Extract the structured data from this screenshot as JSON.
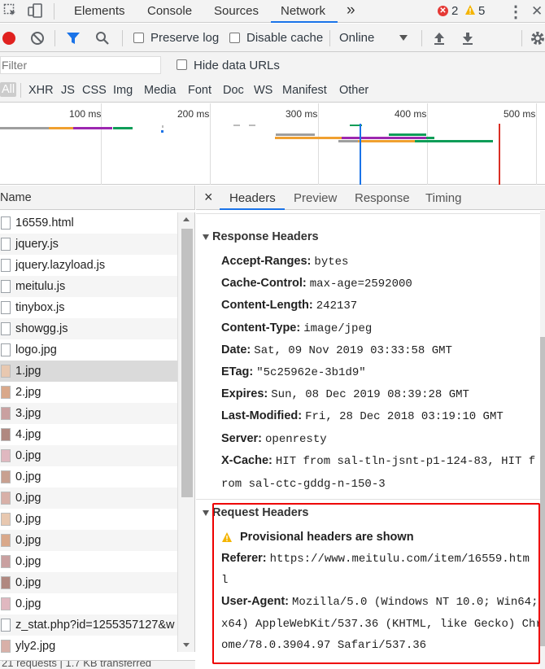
{
  "tabs": {
    "items": [
      "Elements",
      "Console",
      "Sources",
      "Network"
    ],
    "more": "»",
    "errors": "2",
    "warnings": "5",
    "menu": "⋮",
    "close": "✕"
  },
  "toolbar": {
    "preserve_log": "Preserve log",
    "disable_cache": "Disable cache",
    "throttle": "Online"
  },
  "filter": {
    "placeholder": "Filter",
    "hide_data_urls": "Hide data URLs"
  },
  "types": [
    "All",
    "XHR",
    "JS",
    "CSS",
    "Img",
    "Media",
    "Font",
    "Doc",
    "WS",
    "Manifest",
    "Other"
  ],
  "timeline": {
    "ticks": [
      "100 ms",
      "200 ms",
      "300 ms",
      "400 ms",
      "500 ms"
    ]
  },
  "list": {
    "header": "Name",
    "rows": [
      {
        "name": "16559.html",
        "kind": "file"
      },
      {
        "name": "jquery.js",
        "kind": "file"
      },
      {
        "name": "jquery.lazyload.js",
        "kind": "file"
      },
      {
        "name": "meitulu.js",
        "kind": "file"
      },
      {
        "name": "tinybox.js",
        "kind": "file"
      },
      {
        "name": "showgg.js",
        "kind": "file"
      },
      {
        "name": "logo.jpg",
        "kind": "file"
      },
      {
        "name": "1.jpg",
        "kind": "img"
      },
      {
        "name": "2.jpg",
        "kind": "img"
      },
      {
        "name": "3.jpg",
        "kind": "img"
      },
      {
        "name": "4.jpg",
        "kind": "img"
      },
      {
        "name": "0.jpg",
        "kind": "img"
      },
      {
        "name": "0.jpg",
        "kind": "img"
      },
      {
        "name": "0.jpg",
        "kind": "img"
      },
      {
        "name": "0.jpg",
        "kind": "img"
      },
      {
        "name": "0.jpg",
        "kind": "img"
      },
      {
        "name": "0.jpg",
        "kind": "img"
      },
      {
        "name": "0.jpg",
        "kind": "img"
      },
      {
        "name": "0.jpg",
        "kind": "img"
      },
      {
        "name": "z_stat.php?id=1255357127&w",
        "kind": "file"
      },
      {
        "name": "yly2.jpg",
        "kind": "img"
      }
    ],
    "status": "21 requests | 1.7 KB transferred"
  },
  "details": {
    "tabs": [
      "Headers",
      "Preview",
      "Response",
      "Timing"
    ],
    "close": "×",
    "response_title": "Response Headers",
    "response_headers": [
      {
        "k": "Accept-Ranges:",
        "v": "bytes"
      },
      {
        "k": "Cache-Control:",
        "v": "max-age=2592000"
      },
      {
        "k": "Content-Length:",
        "v": "242137"
      },
      {
        "k": "Content-Type:",
        "v": "image/jpeg"
      },
      {
        "k": "Date:",
        "v": "Sat, 09 Nov 2019 03:33:58 GMT"
      },
      {
        "k": "ETag:",
        "v": "\"5c25962e-3b1d9\""
      },
      {
        "k": "Expires:",
        "v": "Sun, 08 Dec 2019 08:39:28 GMT"
      },
      {
        "k": "Last-Modified:",
        "v": "Fri, 28 Dec 2018 03:19:10 GMT"
      },
      {
        "k": "Server:",
        "v": "openresty"
      },
      {
        "k": "X-Cache:",
        "v": "HIT from sal-tln-jsnt-p1-124-83, HIT f"
      }
    ],
    "xcache_cont": "rom sal-ctc-gddg-n-150-3",
    "request_title": "Request Headers",
    "provisional": "Provisional headers are shown",
    "referer_k": "Referer:",
    "referer_v": "https://www.meitulu.com/item/16559.htm",
    "referer_cont": "l",
    "ua_k": "User-Agent:",
    "ua_v": "Mozilla/5.0 (Windows NT 10.0; Win64;",
    "ua_cont1": "x64) AppleWebKit/537.36 (KHTML, like Gecko) Chr",
    "ua_cont2": "ome/78.0.3904.97 Safari/537.36"
  }
}
